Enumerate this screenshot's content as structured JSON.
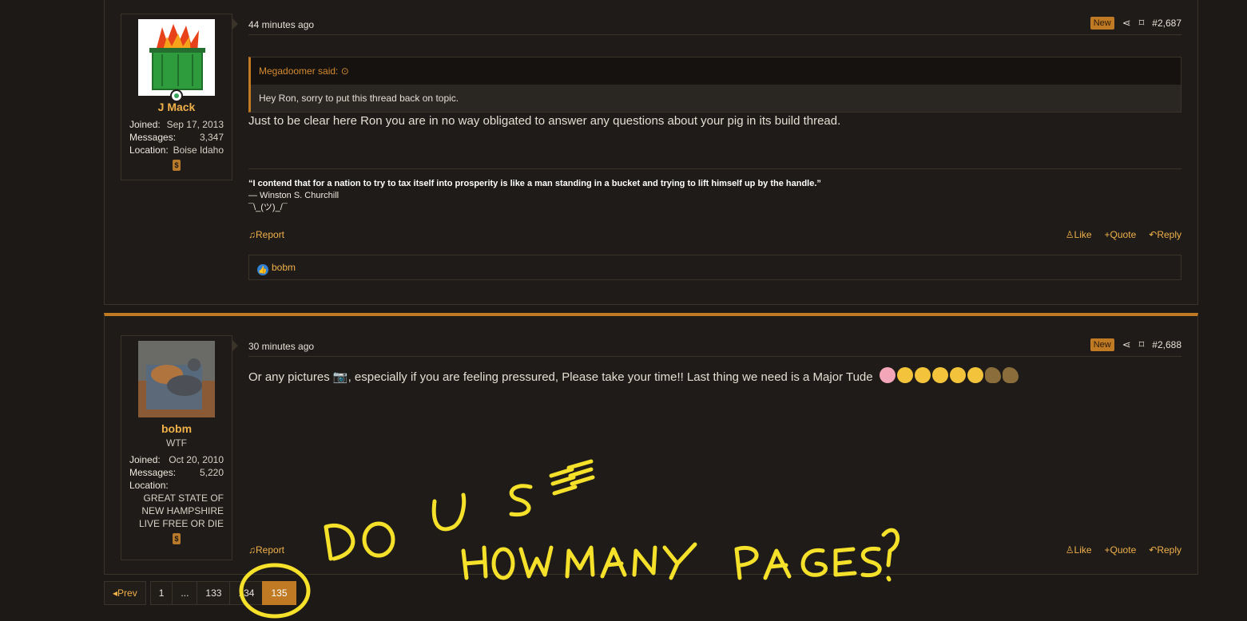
{
  "posts": [
    {
      "time": "44 minutes ago",
      "new_badge": "New",
      "post_number": "#2,687",
      "user": {
        "name": "J Mack",
        "joined_label": "Joined:",
        "joined": "Sep 17, 2013",
        "messages_label": "Messages:",
        "messages": "3,347",
        "location_label": "Location:",
        "location": "Boise Idaho",
        "avatar_icon": "dumpster-fire-icon"
      },
      "quote": {
        "author": "Megadoomer said:",
        "text": "Hey Ron, sorry to put this thread back on topic."
      },
      "body": "Just to be clear here Ron you are in no way obligated to answer any questions about your pig in its build thread.",
      "signature": {
        "quote": "“I contend that for a nation to try to tax itself into prosperity is like a man standing in a bucket and trying to lift himself up by the handle.”",
        "author": "— Winston S. Churchill",
        "shrug": "¯\\_(ツ)_/¯"
      },
      "actions": {
        "report": "Report",
        "like": "Like",
        "quote": "Quote",
        "reply": "Reply"
      },
      "reactions": {
        "user": "bobm"
      }
    },
    {
      "time": "30 minutes ago",
      "new_badge": "New",
      "post_number": "#2,688",
      "user": {
        "name": "bobm",
        "title": "WTF",
        "joined_label": "Joined:",
        "joined": "Oct 20, 2010",
        "messages_label": "Messages:",
        "messages": "5,220",
        "location_label": "Location:",
        "location": "GREAT STATE OF NEW HAMPSHIRE LIVE FREE OR DIE",
        "avatar_icon": "dog-photo-icon"
      },
      "body_before_icon": "Or any pictures",
      "body_after_icon": ", especially if you are feeling pressured, Please take your time!! Last thing we need is a Major Tude",
      "actions": {
        "report": "Report",
        "like": "Like",
        "quote": "Quote",
        "reply": "Reply"
      }
    }
  ],
  "pagination": {
    "prev": "Prev",
    "pages": [
      "1",
      "...",
      "133",
      "134",
      "135"
    ],
    "current": "135"
  },
  "annotation": {
    "line1": "DO U SEE",
    "line2": "HOW MANY PAGES?"
  },
  "colors": {
    "accent": "#c07a24",
    "link": "#f0b14a",
    "annotation": "#f5e02a"
  }
}
